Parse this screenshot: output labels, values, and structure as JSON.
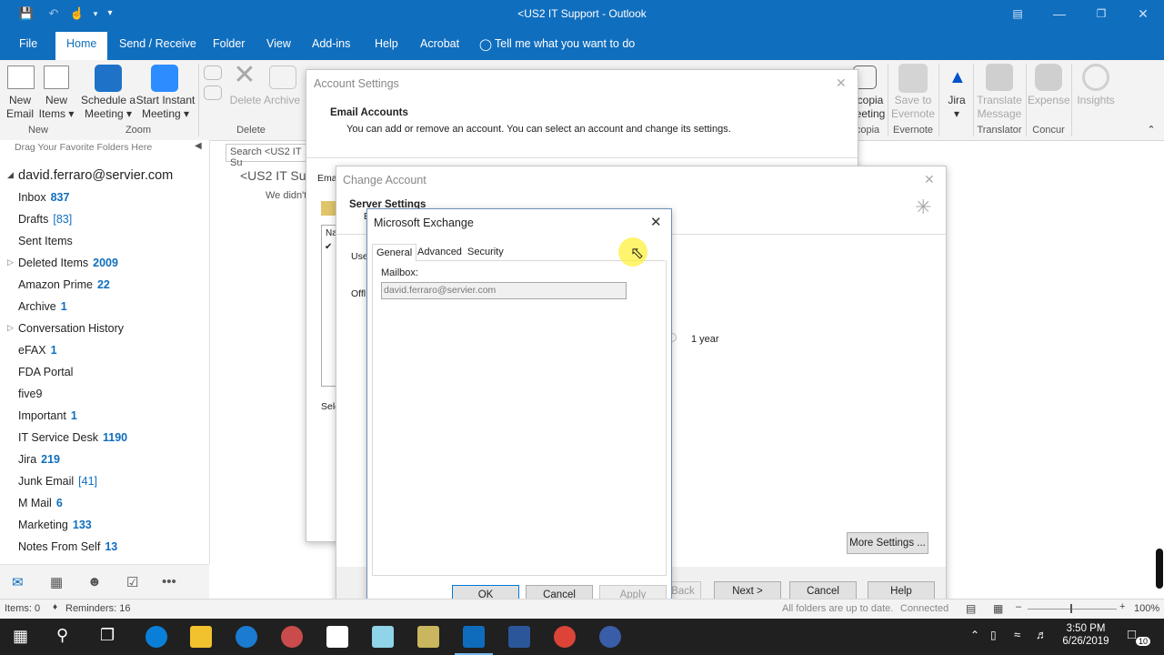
{
  "window": {
    "title": "<US2 IT Support - Outlook",
    "title_display": "<US2 IT Support  -  Outlook"
  },
  "quick_access": [
    "save-icon",
    "undo-icon",
    "touch-mode-icon",
    "customize-icon"
  ],
  "menu_tabs": [
    {
      "label": "File"
    },
    {
      "label": "Home",
      "active": true
    },
    {
      "label": "Send / Receive"
    },
    {
      "label": "Folder"
    },
    {
      "label": "View"
    },
    {
      "label": "Add-ins"
    },
    {
      "label": "Help"
    },
    {
      "label": "Acrobat"
    },
    {
      "label": "Tell me what you want to do"
    }
  ],
  "ribbon": {
    "new_email": [
      "New",
      "Email"
    ],
    "new_items": [
      "New",
      "Items ▾"
    ],
    "schedule_meeting": [
      "Schedule a",
      "Meeting ▾"
    ],
    "start_instant_meeting": [
      "Start Instant",
      "Meeting ▾"
    ],
    "delete": "Delete",
    "archive": "Archive",
    "groups": {
      "new": "New",
      "zoom": "Zoom",
      "delete": "Delete",
      "evernote": "Evernote",
      "translator": "Translator",
      "concur": "Concur"
    },
    "partial_copia": [
      "copia",
      "eeting"
    ],
    "partial_copia_group": "copia",
    "save_to_evernote": [
      "Save to",
      "Evernote"
    ],
    "jira": [
      "Jira",
      "▾"
    ],
    "translate_message": [
      "Translate",
      "Message"
    ],
    "expense": "Expense",
    "insights": "Insights",
    "accent": "#106ebe"
  },
  "folder_pane": {
    "drag_hint": "Drag Your Favorite Folders Here",
    "account": "david.ferraro@servier.com",
    "folders": [
      {
        "name": "Inbox",
        "count": "837"
      },
      {
        "name": "Drafts",
        "count": "[83]",
        "bracket": true
      },
      {
        "name": "Sent Items",
        "count": ""
      },
      {
        "name": "Deleted Items",
        "count": "2009",
        "expander": true
      },
      {
        "name": "Amazon Prime",
        "count": "22"
      },
      {
        "name": "Archive",
        "count": "1"
      },
      {
        "name": "Conversation History",
        "count": "",
        "expander": true
      },
      {
        "name": "eFAX",
        "count": "1"
      },
      {
        "name": "FDA Portal",
        "count": ""
      },
      {
        "name": "five9",
        "count": ""
      },
      {
        "name": "Important",
        "count": "1"
      },
      {
        "name": "IT Service Desk",
        "count": "1190"
      },
      {
        "name": "Jira",
        "count": "219"
      },
      {
        "name": "Junk Email",
        "count": "[41]",
        "bracket": true
      },
      {
        "name": "M Mail",
        "count": "6"
      },
      {
        "name": "Marketing",
        "count": "133"
      },
      {
        "name": "Notes From Self",
        "count": "13"
      }
    ],
    "nav_icons": [
      "mail-icon",
      "calendar-icon",
      "people-icon",
      "tasks-icon",
      "more-icon"
    ]
  },
  "mail_list": {
    "search_placeholder": "Search <US2 IT Su",
    "folder_title": "<US2 IT Sup",
    "empty_text": "We didn't"
  },
  "account_settings": {
    "title": "Account Settings",
    "heading": "Email Accounts",
    "desc": "You can add or remove an account. You can select an account and change its settings.",
    "partial_tab": "Ema",
    "partial_name": "Na",
    "partial_sel": "Sele"
  },
  "change_account": {
    "title": "Change Account",
    "heading": "Server Settings",
    "partial_e": "E",
    "partial_use": "Use",
    "partial_off": "Offl",
    "slider_value": "1 year",
    "more_settings": "More Settings ...",
    "back": "< Back",
    "back_visible": "Back",
    "next": "Next >",
    "cancel": "Cancel",
    "help": "Help"
  },
  "exchange_dialog": {
    "title": "Microsoft Exchange",
    "tabs": [
      "General",
      "Advanced",
      "Security"
    ],
    "mailbox_label": "Mailbox:",
    "mailbox_value": "david.ferraro@servier.com",
    "ok": "OK",
    "cancel": "Cancel",
    "apply": "Apply"
  },
  "status_bar": {
    "items": "Items: 0",
    "reminders": "Reminders: 16",
    "sync_status": "All folders are up to date.",
    "connection": "Connected",
    "zoom": "100%"
  },
  "taskbar": {
    "time": "3:50 PM",
    "date": "6/26/2019",
    "notifications": "10"
  }
}
